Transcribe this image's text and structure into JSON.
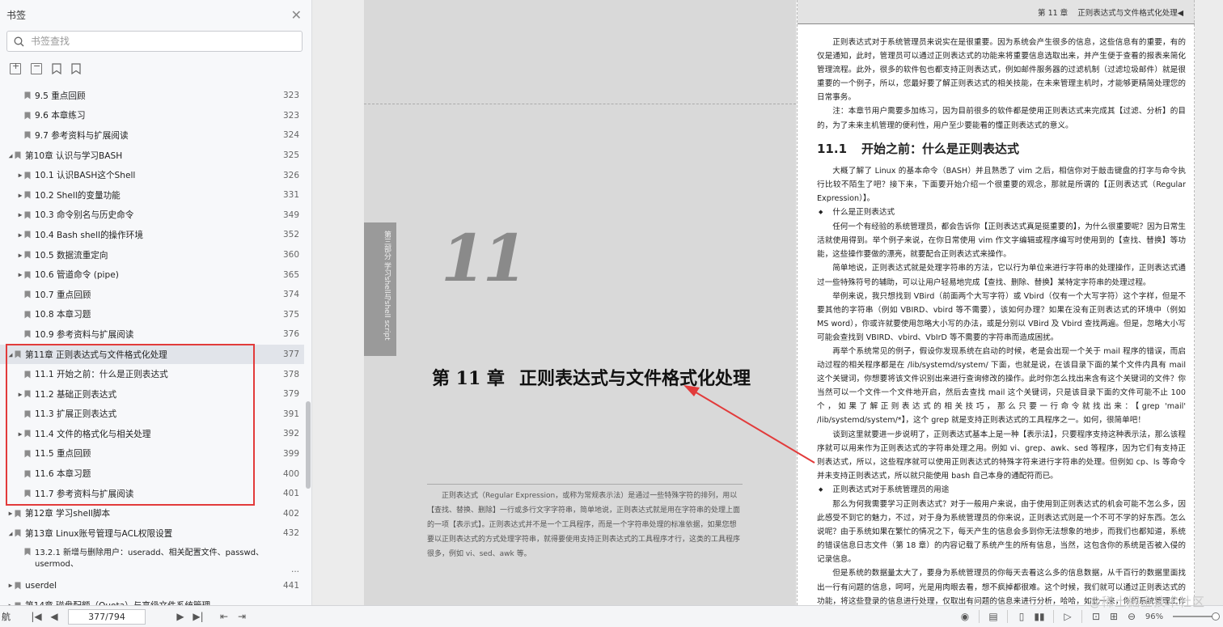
{
  "sidebar": {
    "title": "书签",
    "search_placeholder": "书签查找",
    "items": [
      {
        "label": "9.5 重点回顾",
        "page": "323",
        "level": 2,
        "arrow": false
      },
      {
        "label": "9.6 本章练习",
        "page": "323",
        "level": 2,
        "arrow": false
      },
      {
        "label": "9.7 参考资料与扩展阅读",
        "page": "324",
        "level": 2,
        "arrow": false
      },
      {
        "label": "第10章 认识与学习BASH",
        "page": "325",
        "level": 1,
        "arrow": true,
        "expanded": true
      },
      {
        "label": "10.1 认识BASH这个Shell",
        "page": "326",
        "level": 2,
        "arrow": true
      },
      {
        "label": "10.2 Shell的变量功能",
        "page": "331",
        "level": 2,
        "arrow": true
      },
      {
        "label": "10.3 命令别名与历史命令",
        "page": "349",
        "level": 2,
        "arrow": true
      },
      {
        "label": "10.4 Bash shell的操作环境",
        "page": "352",
        "level": 2,
        "arrow": true
      },
      {
        "label": "10.5 数据流重定向",
        "page": "360",
        "level": 2,
        "arrow": true
      },
      {
        "label": "10.6 管道命令 (pipe)",
        "page": "365",
        "level": 2,
        "arrow": true
      },
      {
        "label": "10.7 重点回顾",
        "page": "374",
        "level": 2,
        "arrow": false
      },
      {
        "label": "10.8 本章习题",
        "page": "375",
        "level": 2,
        "arrow": false
      },
      {
        "label": "10.9 参考资料与扩展阅读",
        "page": "376",
        "level": 2,
        "arrow": false
      },
      {
        "label": "第11章 正则表达式与文件格式化处理",
        "page": "377",
        "level": 1,
        "arrow": true,
        "expanded": true,
        "selected": true
      },
      {
        "label": "11.1 开始之前：什么是正则表达式",
        "page": "378",
        "level": 2,
        "arrow": false
      },
      {
        "label": "11.2 基础正则表达式",
        "page": "379",
        "level": 2,
        "arrow": true
      },
      {
        "label": "11.3 扩展正则表达式",
        "page": "391",
        "level": 2,
        "arrow": false
      },
      {
        "label": "11.4 文件的格式化与相关处理",
        "page": "392",
        "level": 2,
        "arrow": true
      },
      {
        "label": "11.5 重点回顾",
        "page": "399",
        "level": 2,
        "arrow": false
      },
      {
        "label": "11.6 本章习题",
        "page": "400",
        "level": 2,
        "arrow": false
      },
      {
        "label": "11.7 参考资料与扩展阅读",
        "page": "401",
        "level": 2,
        "arrow": false
      },
      {
        "label": "第12章 学习shell脚本",
        "page": "402",
        "level": 1,
        "arrow": true
      },
      {
        "label": "第13章 Linux账号管理与ACL权限设置",
        "page": "432",
        "level": 1,
        "arrow": true,
        "expanded": true
      },
      {
        "label": "13.2.1 新增与删除用户：useradd、相关配置文件、passwd、usermod、",
        "page": "...",
        "level": 2,
        "arrow": false,
        "tall": true
      },
      {
        "label": "userdel",
        "page": "441",
        "level": 1,
        "arrow": true
      },
      {
        "label": "第14章 磁盘配额（Quota）与高级文件系统管理",
        "page": "",
        "level": 1,
        "arrow": true
      }
    ]
  },
  "document": {
    "left_page": {
      "side_tab": "第三部分 学习shell与shell script",
      "chapter_number": "11",
      "chapter_label": "第 11 章",
      "chapter_title": "正则表达式与文件格式化处理",
      "abstract": "正则表达式（Regular Expression，或称为常规表示法）是通过一些特殊字符的排列，用以【查找、替换、删除】一行或多行文字字符串，简单地说，正则表达式就是用在字符串的处理上面的一项【表示式】。正则表达式并不是一个工具程序，而是一个字符串处理的标准依据，如果您想要以正则表达式的方式处理字符串，就得要使用支持正则表达式的工具程序才行，这类的工具程序很多，例如 vi、sed、awk 等。"
    },
    "right_page": {
      "running_head_chapter": "第 11 章",
      "running_head_title": "正则表达式与文件格式化处理◀",
      "p1": "正则表达式对于系统管理员来说实在是很重要。因为系统会产生很多的信息，这些信息有的重要，有的仅是通知，此时，管理员可以通过正则表达式的功能来将重要信息选取出来，并产生便于查看的报表来简化管理流程。此外，很多的软件包也都支持正则表达式，例如邮件服务器的过滤机制（过滤垃圾邮件）就是很重要的一个例子，所以，您最好要了解正则表达式的相关技能，在未来管理主机时，才能够更精简处理您的日常事务。",
      "p2": "注：本章节用户需要多加练习，因为目前很多的软件都是使用正则表达式来完成其【过滤、分析】的目的，为了未来主机管理的便利性，用户至少要能看的懂正则表达式的意义。",
      "sec_num": "11.1",
      "sec_title": "开始之前：什么是正则表达式",
      "p3": "大概了解了 Linux 的基本命令（BASH）并且熟悉了 vim 之后，相信你对于敲击键盘的打字与命令执行比较不陌生了吧？接下来，下面要开始介绍一个很重要的观念，那就是所谓的【正则表达式（Regular Expression）】。",
      "b1": "什么是正则表达式",
      "p4": "任何一个有经验的系统管理员，都会告诉你【正则表达式真是挺重要的】，为什么很重要呢？因为日常生活就使用得到。举个例子来说，在你日常使用 vim 作文字编辑或程序编写时使用到的【查找、替换】等功能，这些操作要做的漂亮，就要配合正则表达式来操作。",
      "p5": "简单地说，正则表达式就是处理字符串的方法，它以行为单位来进行字符串的处理操作，正则表达式通过一些特殊符号的辅助，可以让用户轻易地完成【查找、删除、替换】某特定字符串的处理过程。",
      "p6": "举例来说，我只想找到 VBird（前面两个大写字符）或 Vbird（仅有一个大写字符）这个字样，但是不要其他的字符串（例如 VBIRD、vbird 等不需要），该如何办理？如果在没有正则表达式的环境中（例如 MS word），你或许就要使用忽略大小写的办法，或是分别以 VBird 及 Vbird 查找两遍。但是，忽略大小写可能会查找到 VBIRD、vbird、VbIrD 等不需要的字符串而造成困扰。",
      "p7": "再举个系统常见的例子，假设你发现系统在启动的时候，老是会出现一个关于 mail 程序的错误，而启动过程的相关程序都是在 /lib/systemd/system/ 下面，也就是说，在该目录下面的某个文件内具有 mail 这个关键词，你想要将该文件识别出来进行查询修改的操作。此时你怎么找出来含有这个关键词的文件？你当然可以一个文件一个文件地开启，然后去查找 mail 这个关键词，只是该目录下面的文件可能不止 100 个，如果了解正则表达式的相关技巧，那么只要一行命令就找出来：【grep 'mail' /lib/systemd/system/*】，这个 grep 就是支持正则表达式的工具程序之一。如何，很简单吧！",
      "p8": "谈到这里就要进一步说明了，正则表达式基本上是一种【表示法】，只要程序支持这种表示法，那么该程序就可以用来作为正则表达式的字符串处理之用。例如 vi、grep、awk、sed 等程序，因为它们有支持正则表达式，所以，这些程序就可以使用正则表达式的特殊字符来进行字符串的处理。但例如 cp、ls 等命令并未支持正则表达式，所以就只能使用 bash 自己本身的通配符而已。",
      "b2": "正则表达式对于系统管理员的用途",
      "p9": "那么为何我需要学习正则表达式？对于一般用户来说，由于使用到正则表达式的机会可能不怎么多，因此感受不到它的魅力，不过，对于身为系统管理员的你来说，正则表达式则是一个不可不学的好东西。怎么说呢？由于系统如果在繁忙的情况之下，每天产生的信息会多到你无法想象的地步，而我们也都知道，系统的错误信息日志文件（第 18 章）的内容记载了系统产生的所有信息，当然，这包含你的系统是否被入侵的记录信息。",
      "p10": "但是系统的数据量太大了，要身为系统管理员的你每天去看这么多的信息数据，从千百行的数据里面找出一行有问题的信息，呵呵，光是用肉眼去看，想不疯掉都很难。这个时候，我们就可以通过正则表达式的功能，将这些登录的信息进行处理，仅取出有问题的信息来进行分析，哈哈，如此一来，你的系统管理工作将会【快乐得不得了】，当然，正则表达式的优点还不止于此，等你有一定程度的了"
    }
  },
  "bottombar": {
    "nav_label": "航",
    "page_value": "377/794",
    "zoom": "96%"
  },
  "watermark": "@稀土掘金技术社区",
  "colors": {
    "highlight": "#e23b3b",
    "selected_row": "#e1e4ea"
  }
}
